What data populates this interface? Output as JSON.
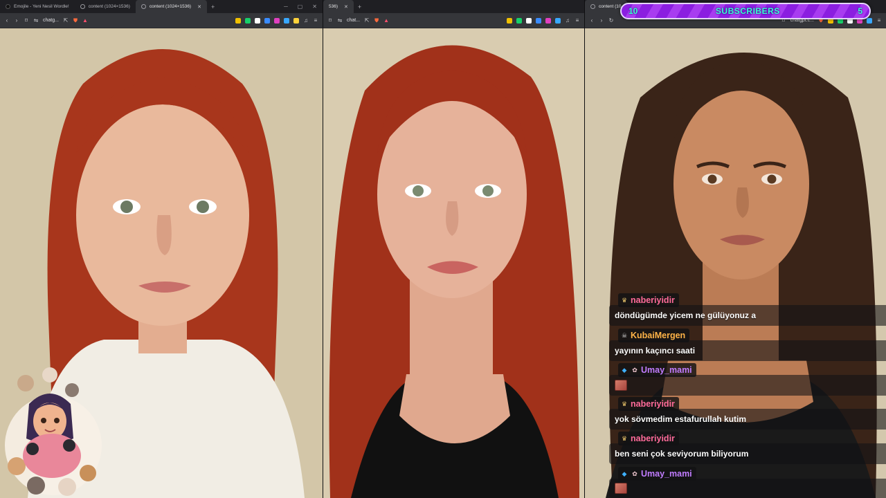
{
  "windows": [
    {
      "tabs": [
        {
          "title": "Emojile - Yeni Nesil Wordle!",
          "active": false,
          "favicon": "dark-square"
        },
        {
          "title": "content (1024×1536)",
          "active": false,
          "favicon": "globe"
        },
        {
          "title": "content (1024×1536)",
          "active": true,
          "favicon": "globe"
        }
      ],
      "address": "chatg...",
      "photo": {
        "hair": "#a8361c",
        "skin": "#e9b99c",
        "shirt": "#f1ede4",
        "bg": "#d3c6a8"
      }
    },
    {
      "tabs": [
        {
          "title": "536)",
          "active": true,
          "favicon": "none"
        }
      ],
      "address": "chat...",
      "photo": {
        "hair": "#a1311a",
        "skin": "#e6b29a",
        "shirt": "#111111",
        "bg": "#d9ccb0"
      }
    },
    {
      "tabs": [
        {
          "title": "content (10",
          "active": true,
          "favicon": "globe"
        }
      ],
      "address": "chatgpt.c...",
      "photo": {
        "hair": "#3a2418",
        "skin": "#c98a62",
        "shirt": "#1a1a1a",
        "bg": "#d4c8ad"
      }
    }
  ],
  "subscribers": {
    "label": "SUBSCRIBERS",
    "current": "10",
    "goal": "5"
  },
  "chat": {
    "messages": [
      {
        "username": "naberiyidir",
        "color": "#ff6b9a",
        "badges": [
          "crown-badge"
        ],
        "text": "döndügümde yicem ne gülüyonuz a"
      },
      {
        "username": "KubaiMergen",
        "color": "#ffb347",
        "badges": [
          "pirate-badge"
        ],
        "text": "yayının kaçıncı saati"
      },
      {
        "username": "Umay_mami",
        "color": "#c07cff",
        "badges": [
          "cube-badge",
          "cat-badge"
        ],
        "text": ""
      },
      {
        "username": "naberiyidir",
        "color": "#ff6b9a",
        "badges": [
          "crown-badge"
        ],
        "text": "yok sövmedim estafurullah kutim"
      },
      {
        "username": "naberiyidir",
        "color": "#ff6b9a",
        "badges": [
          "crown-badge"
        ],
        "text": "ben seni çok seviyorum biliyorum"
      },
      {
        "username": "Umay_mami",
        "color": "#c07cff",
        "badges": [
          "cube-badge",
          "cat-badge"
        ],
        "text": ""
      }
    ]
  },
  "colors": {
    "accent": "#a83cf0",
    "subText": "#38ffd6"
  }
}
